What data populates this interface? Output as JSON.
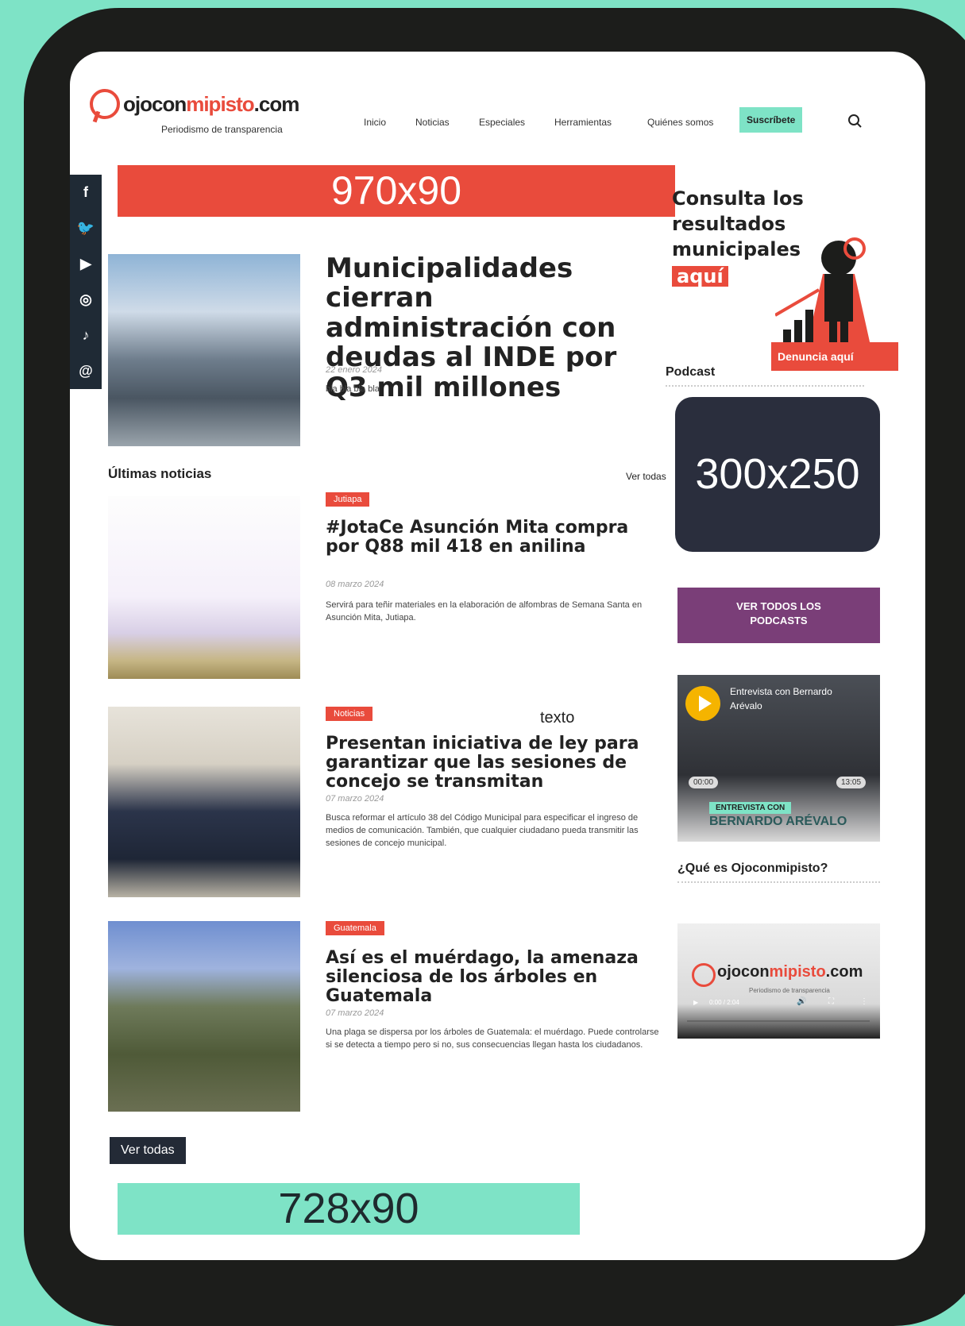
{
  "brand": {
    "name_prefix": "ojocon",
    "name_mid": "mipisto",
    ".com": ".com",
    "tagline": "Periodismo de transparencia"
  },
  "nav": {
    "items": [
      "Inicio",
      "Noticias",
      "Especiales",
      "Herramientas",
      "Quiénes somos"
    ],
    "subscribe": "Suscríbete"
  },
  "ads": {
    "top": "970x90",
    "side": "300x250",
    "bottom": "728x90"
  },
  "featured": {
    "title": "Municipalidades cierran administración con deudas al INDE por Q3 mil millones",
    "date": "22 enero 2024",
    "excerpt": "bla bla bla bla"
  },
  "latest": {
    "heading": "Últimas noticias",
    "see_all": "Ver todas",
    "floating_text": "texto",
    "articles": [
      {
        "tag": "Jutiapa",
        "title": "#JotaCe Asunción Mita compra por Q88 mil 418 en anilina",
        "date": "08 marzo 2024",
        "excerpt": "Servirá para teñir materiales en la elaboración de alfombras de Semana Santa en Asunción Mita, Jutiapa."
      },
      {
        "tag": "Noticias",
        "title": "Presentan iniciativa de ley para garantizar que las sesiones de concejo se transmitan",
        "date": "07 marzo 2024",
        "excerpt": "Busca reformar el artículo 38 del Código Municipal para especificar el ingreso de medios de comunicación. También, que cualquier ciudadano pueda transmitir las sesiones de concejo municipal."
      },
      {
        "tag": "Guatemala",
        "title": "Así es el muérdago, la amenaza silenciosa de los árboles en Guatemala",
        "date": "07 marzo 2024",
        "excerpt": "Una plaga se dispersa por los árboles de Guatemala: el muérdago. Puede controlarse si se detecta a tiempo pero si no, sus consecuencias llegan hasta los ciudadanos."
      }
    ],
    "see_all_button": "Ver todas"
  },
  "sidebar": {
    "promo": {
      "line1": "Consulta los",
      "line2": "resultados",
      "line3": "municipales",
      "highlight": "aquí"
    },
    "denuncia": "Denuncia aquí",
    "podcast_heading": "Podcast",
    "podcasts_button": "VER TODOS LOS PODCASTS",
    "player": {
      "title": "Entrevista con Bernardo Arévalo",
      "time_start": "00:00",
      "time_end": "13:05",
      "banner": "BERNARDO ARÉVALO",
      "banner_small": "ENTREVISTA CON"
    },
    "about_heading": "¿Qué es Ojoconmipisto?",
    "video": {
      "time": "0:00 / 2:04",
      "tagline": "Periodismo de transparencia"
    }
  },
  "social_icons": [
    "facebook-icon",
    "twitter-icon",
    "youtube-icon",
    "instagram-icon",
    "tiktok-icon",
    "threads-icon"
  ]
}
